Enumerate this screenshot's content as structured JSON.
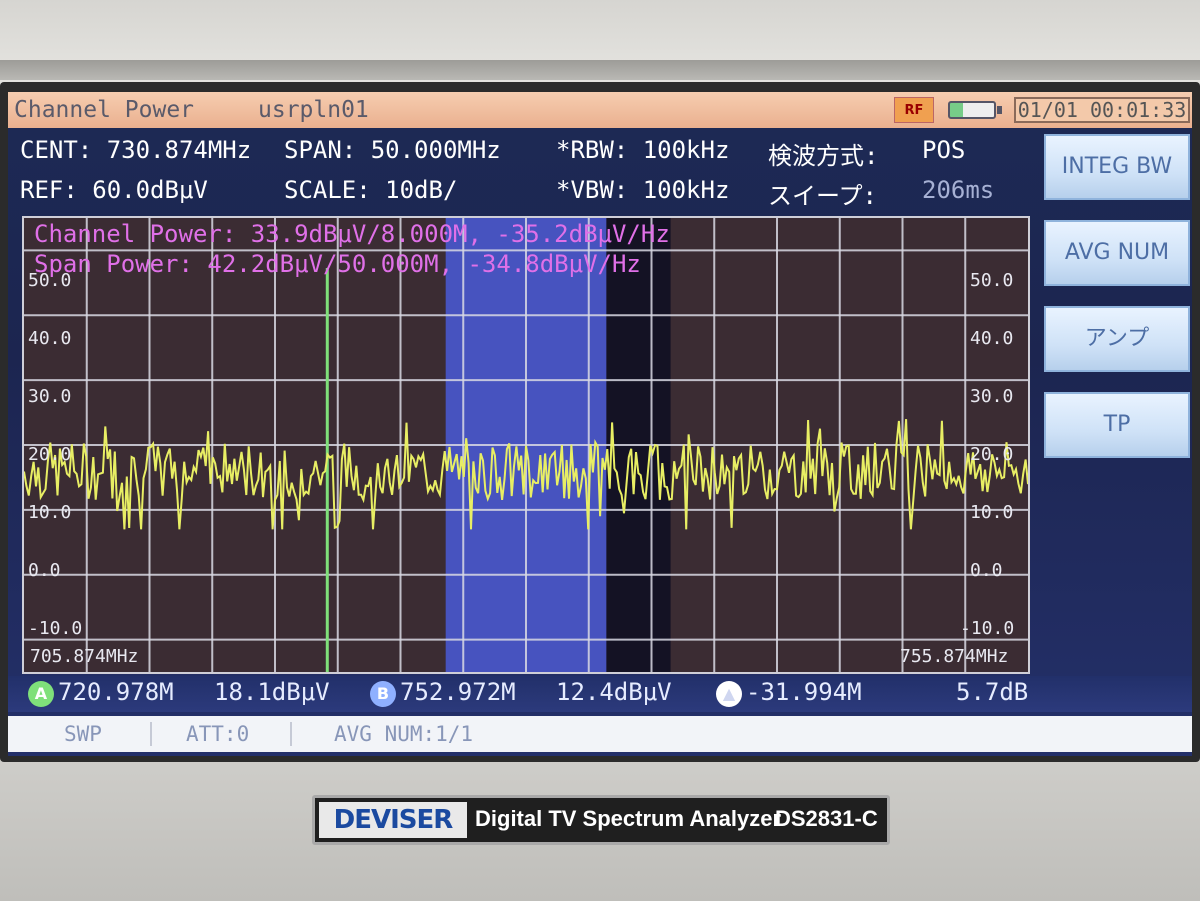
{
  "title_bar": {
    "mode": "Channel Power",
    "file": "usrpln01",
    "rf_indicator": "RF",
    "datetime": "01/01 00:01:33"
  },
  "params": {
    "cent": "CENT: 730.874MHz",
    "span": "SPAN:  50.000MHz",
    "rbw": "*RBW:  100kHz",
    "detect_label": "検波方式:",
    "detect_value": "POS",
    "ref": "REF:  60.0dBμV",
    "scale": "SCALE: 10dB/",
    "vbw": "*VBW:  100kHz",
    "sweep_label": "スイープ:",
    "sweep_value": "206ms"
  },
  "readouts": {
    "channel_power": "Channel Power: 33.9dBμV/8.000M, -35.2dBμV/Hz",
    "span_power": "Span Power: 42.2dBμV/50.000M, -34.8dBμV/Hz"
  },
  "softkeys": [
    "INTEG BW",
    "AVG NUM",
    "アンプ",
    "TP"
  ],
  "markers": {
    "a_freq": "720.978M",
    "a_level": "18.1dBμV",
    "b_freq": "752.972M",
    "b_level": "12.4dBμV",
    "delta_freq": "-31.994M",
    "delta_level": "5.7dB",
    "a_symbol": "A",
    "b_symbol": "B",
    "delta_symbol": "▲",
    "a_color": "#7fe07a",
    "b_color": "#8fb0ff",
    "delta_color": "#ffffff"
  },
  "status": {
    "swp": "SWP",
    "att": "ATT:0",
    "avg": "AVG NUM:1/1"
  },
  "brand": {
    "logo": "DEVISER",
    "product": "Digital TV Spectrum Analyzer",
    "model": "DS2831-C"
  },
  "chart_data": {
    "type": "line",
    "x_start": "705.874MHz",
    "x_end": "755.874MHz",
    "y_tick_labels_left": [
      "50.0",
      "40.0",
      "30.0",
      "20.0",
      "10.0",
      "0.0",
      "-10.0"
    ],
    "y_tick_labels_right": [
      "50.0",
      "40.0",
      "30.0",
      "20.0",
      "10.0",
      "0.0",
      "-10.0"
    ],
    "ylim": [
      -15,
      55
    ],
    "xlim_mhz": [
      705.874,
      755.874
    ],
    "trace_color": "#e8ee64",
    "trace_level_mean_dbuv": 16,
    "trace_level_range_dbuv": [
      7,
      24
    ],
    "channel_band_mhz": [
      726.874,
      734.874
    ],
    "marker_line_mhz": 720.978,
    "marker_line_color": "#7fe07a",
    "band_fill_color": "#4a5bd8",
    "grid": true
  }
}
